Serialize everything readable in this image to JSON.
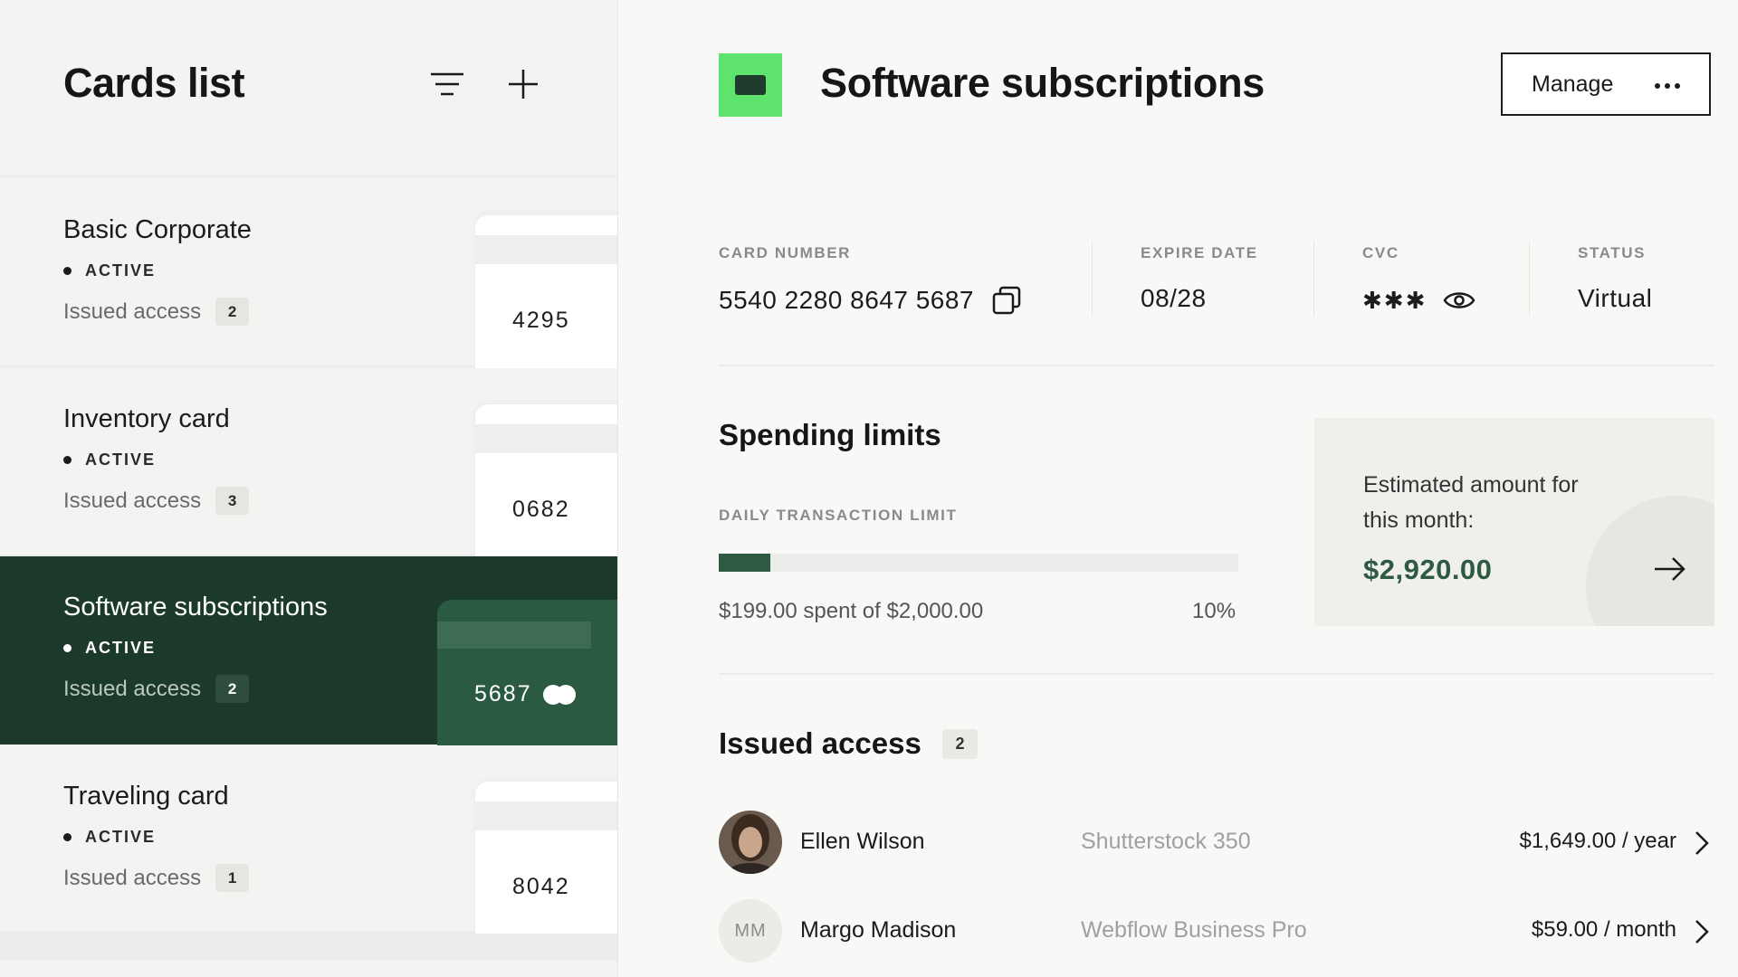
{
  "sidebar": {
    "title": "Cards list",
    "cards": [
      {
        "name": "Basic Corporate",
        "status": "ACTIVE",
        "access_label": "Issued access",
        "access_count": "2",
        "last4": "4295"
      },
      {
        "name": "Inventory card",
        "status": "ACTIVE",
        "access_label": "Issued access",
        "access_count": "3",
        "last4": "0682"
      },
      {
        "name": "Software subscriptions",
        "status": "ACTIVE",
        "access_label": "Issued access",
        "access_count": "2",
        "last4": "5687"
      },
      {
        "name": "Traveling card",
        "status": "ACTIVE",
        "access_label": "Issued access",
        "access_count": "1",
        "last4": "8042"
      }
    ]
  },
  "detail": {
    "title": "Software subscriptions",
    "manage_label": "Manage",
    "card_number_label": "CARD NUMBER",
    "card_number": "5540 2280 8647 5687",
    "expire_label": "EXPIRE DATE",
    "expire_date": "08/28",
    "cvc_label": "CVC",
    "cvc_masked": "✱✱✱",
    "status_label": "STATUS",
    "status": "Virtual",
    "spending_title": "Spending limits",
    "limit_label": "DAILY TRANSACTION LIMIT",
    "limit_fraction": 0.1,
    "spent_text": "$199.00 spent of $2,000.00",
    "percent_text": "10%",
    "estimate_text": "Estimated amount for this month:",
    "estimate_amount": "$2,920.00",
    "issued_title": "Issued access",
    "issued_count": "2",
    "access": [
      {
        "name": "Ellen Wilson",
        "service": "Shutterstock 350",
        "amount": "$1,649.00 / year",
        "initials": ""
      },
      {
        "name": "Margo Madison",
        "service": "Webflow Business Pro",
        "amount": "$59.00 / month",
        "initials": "MM"
      }
    ]
  },
  "colors": {
    "accent_green": "#5ee36d",
    "dark_green": "#1c3a2b",
    "progress_green": "#2d5a41"
  }
}
